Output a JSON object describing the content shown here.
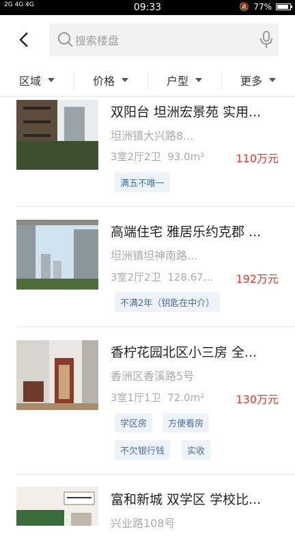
{
  "status": {
    "signal": "2G 4G 4G",
    "time": "09:33",
    "battery": "77%"
  },
  "search": {
    "placeholder": "搜索楼盘"
  },
  "filters": [
    "区域",
    "价格",
    "户型",
    "更多"
  ],
  "listings": [
    {
      "title": "双阳台 坦洲宏景苑 实用...",
      "address": "坦洲镇大兴路8...",
      "layout": "3室2厅2卫",
      "area": "93.0m²",
      "price": "110万元",
      "tags": [
        "满五不唯一"
      ]
    },
    {
      "title": "高端住宅 雅居乐约克郡 ...",
      "address": "坦洲镇坦神南路...",
      "layout": "3室2厅2卫",
      "area": "128.67...",
      "price": "192万元",
      "tags": [
        "不满2年（钥匙在中介）"
      ]
    },
    {
      "title": "香柠花园北区小三房 全...",
      "address": "香洲区香溪路5号",
      "layout": "3室1厅1卫",
      "area": "72.0m²",
      "price": "130万元",
      "tags": [
        "学区房",
        "方便看房",
        "不欠银行钱",
        "实收"
      ]
    },
    {
      "title": "富和新城 双学区 学校比...",
      "address": "兴业路108号",
      "layout": "",
      "area": "",
      "price": "",
      "tags": []
    }
  ]
}
